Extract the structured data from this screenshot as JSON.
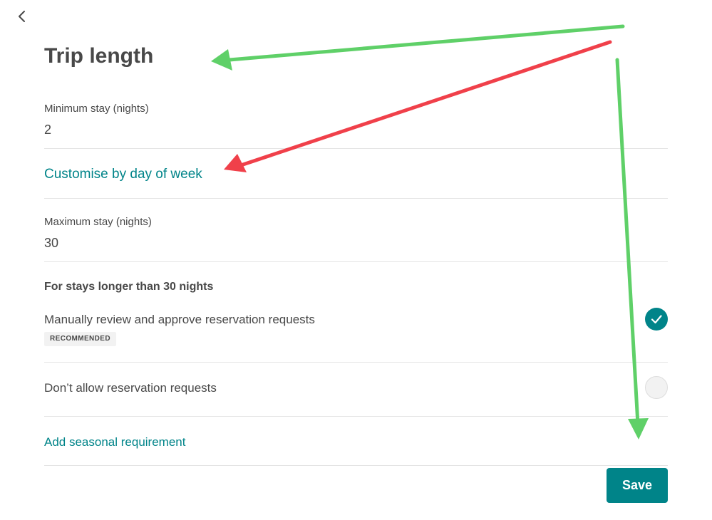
{
  "page": {
    "title": "Trip length"
  },
  "min_stay": {
    "label": "Minimum stay (nights)",
    "value": "2"
  },
  "customise_link": "Customise by day of week",
  "max_stay": {
    "label": "Maximum stay (nights)",
    "value": "30"
  },
  "long_stays": {
    "heading": "For stays longer than 30 nights",
    "options": [
      {
        "label": "Manually review and approve reservation requests",
        "badge": "RECOMMENDED",
        "selected": true
      },
      {
        "label": "Don’t allow reservation requests",
        "selected": false
      }
    ]
  },
  "seasonal_link": "Add seasonal requirement",
  "save_label": "Save",
  "icons": {
    "back": "chevron-left-icon",
    "check": "checkmark-icon"
  },
  "colors": {
    "accent": "#008489",
    "text": "#484848",
    "divider": "#e4e4e4",
    "annotation_green": "#5fd068",
    "annotation_red": "#f0404a"
  }
}
